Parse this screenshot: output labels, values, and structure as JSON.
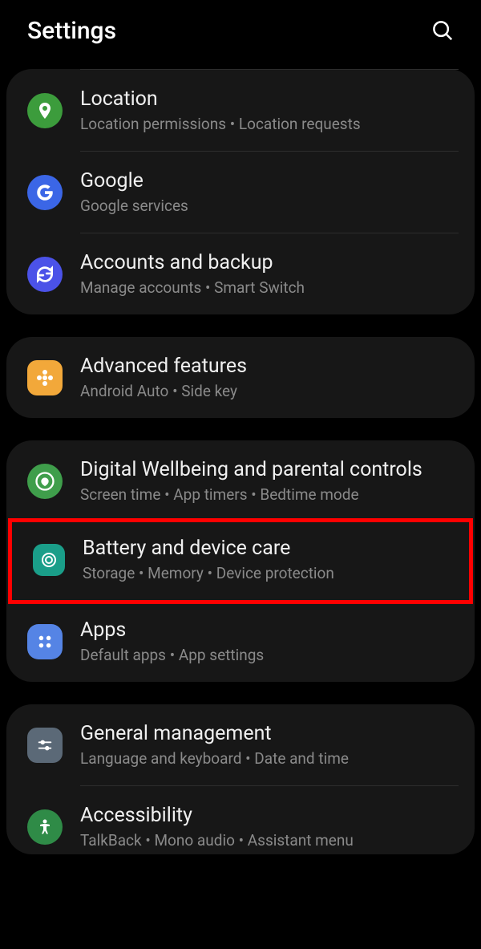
{
  "header": {
    "title": "Settings"
  },
  "groups": [
    {
      "items": [
        {
          "title": "Location",
          "subtitle": "Location permissions  •  Location requests",
          "icon": "location",
          "color": "#3c9c3c"
        },
        {
          "title": "Google",
          "subtitle": "Google services",
          "icon": "google",
          "color": "#3b66e6"
        },
        {
          "title": "Accounts and backup",
          "subtitle": "Manage accounts  •  Smart Switch",
          "icon": "sync",
          "color": "#4b52e8"
        }
      ]
    },
    {
      "items": [
        {
          "title": "Advanced features",
          "subtitle": "Android Auto  •  Side key",
          "icon": "flower",
          "color": "#f2a83a"
        }
      ]
    },
    {
      "items": [
        {
          "title": "Digital Wellbeing and parental controls",
          "subtitle": "Screen time  •  App timers  •  Bedtime mode",
          "icon": "wellbeing",
          "color": "#3f9e4b"
        },
        {
          "title": "Battery and device care",
          "subtitle": "Storage  •  Memory  •  Device protection",
          "icon": "devicecare",
          "color": "#1a9e89"
        },
        {
          "title": "Apps",
          "subtitle": "Default apps  •  App settings",
          "icon": "apps",
          "color": "#5584e5"
        }
      ]
    },
    {
      "items": [
        {
          "title": "General management",
          "subtitle": "Language and keyboard  •  Date and time",
          "icon": "sliders",
          "color": "#5b6977"
        },
        {
          "title": "Accessibility",
          "subtitle": "TalkBack  •  Mono audio  •  Assistant menu",
          "icon": "accessibility",
          "color": "#2f8b47"
        }
      ]
    }
  ],
  "highlighted": "Battery and device care"
}
